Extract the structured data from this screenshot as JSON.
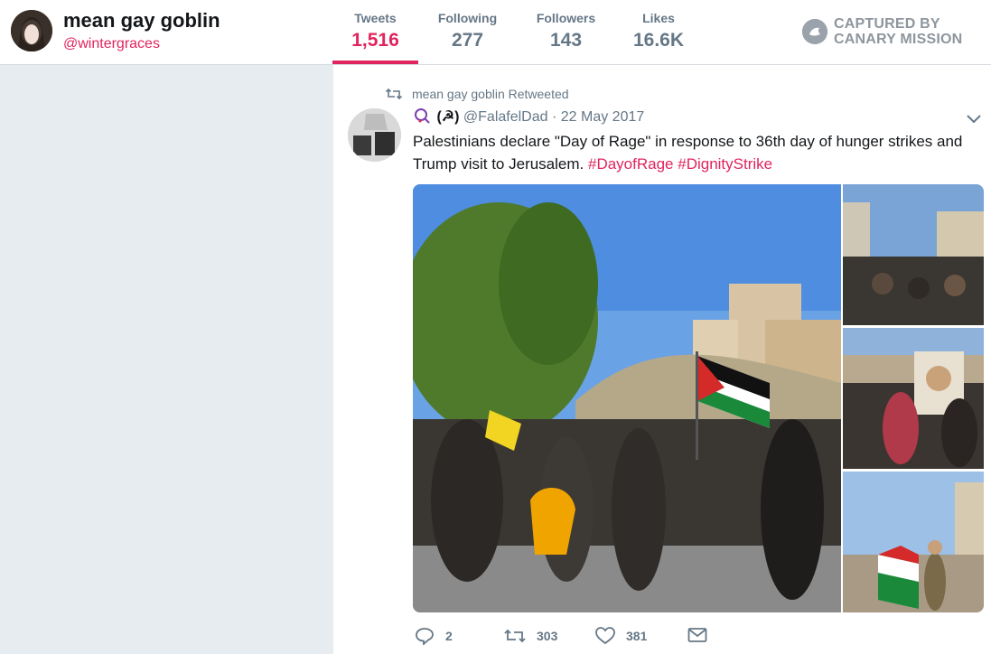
{
  "profile": {
    "display_name": "mean gay goblin",
    "handle": "@wintergraces"
  },
  "stats": [
    {
      "label": "Tweets",
      "value": "1,516"
    },
    {
      "label": "Following",
      "value": "277"
    },
    {
      "label": "Followers",
      "value": "143"
    },
    {
      "label": "Likes",
      "value": "16.6K"
    }
  ],
  "watermark": {
    "line1": "CAPTURED BY",
    "line2": "CANARY MISSION"
  },
  "tweet": {
    "retweet_note": "mean gay goblin Retweeted",
    "author_emoji": "(☭)",
    "author_handle": "@FalafelDad",
    "date": "· 22 May 2017",
    "text_main": "Palestinians declare \"Day of Rage\" in response to 36th day of hunger strikes and Trump visit to Jerusalem.",
    "hashtag1": "#DayofRage",
    "hashtag2": "#DignityStrike",
    "replies": "2",
    "retweets": "303",
    "likes": "381"
  },
  "colors": {
    "accent": "#e0245e",
    "muted": "#657786",
    "background": "#e6ecf0"
  }
}
